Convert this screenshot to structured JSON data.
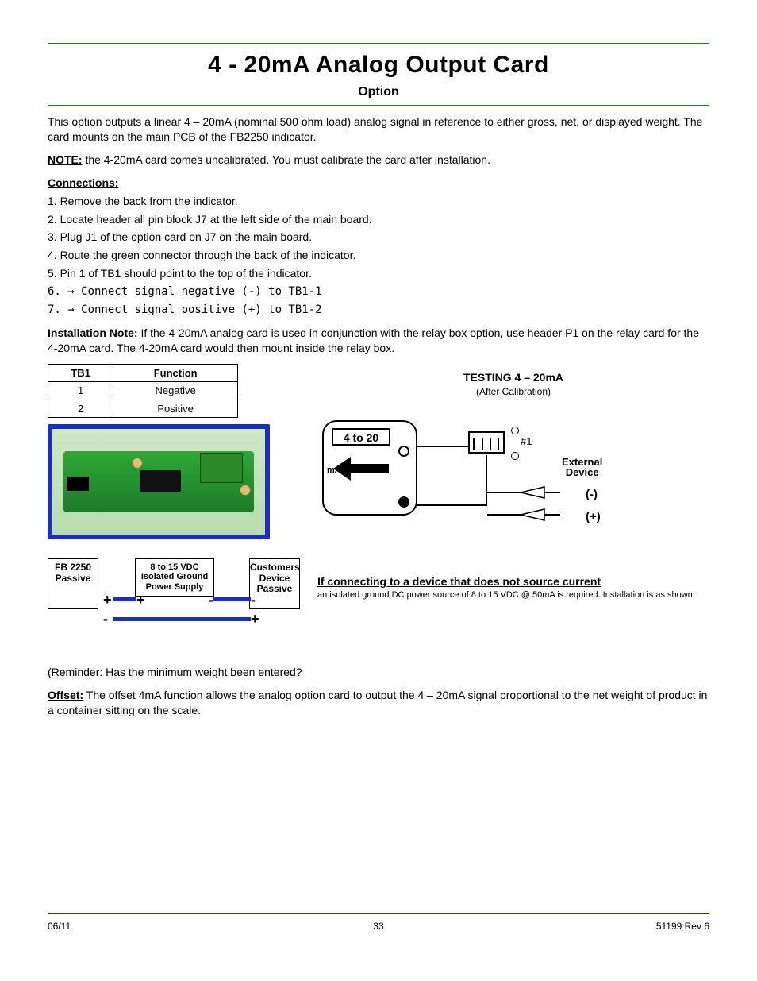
{
  "header": {
    "title": "4 - 20mA Analog Output Card",
    "subtitle": "Option"
  },
  "intro": "This option outputs a linear 4 – 20mA (nominal 500 ohm load) analog signal in reference to either gross, net, or displayed weight. The card mounts on the main PCB of the FB2250 indicator.",
  "note_label": "NOTE:",
  "note_text": " the 4-20mA card comes uncalibrated. You must calibrate the card after installation.",
  "conn_label": "Connections:",
  "conn_steps": [
    "1. Remove the back from the indicator.",
    "2. Locate header all pin block J7 at the left side of the main board.",
    "3. Plug J1 of the option card on J7 on the main board.",
    "4. Route the green connector through the back of the indicator.",
    "5. Pin 1 of TB1 should point to the top of the indicator.",
    "6. → Connect signal negative (-) to TB1-1",
    "7. → Connect signal positive (+) to TB1-2"
  ],
  "install_note_label": "Installation Note:",
  "install_note_text": " If the 4-20mA analog card is used in conjunction with the relay box option, use header P1 on the relay card for the 4-20mA card. The 4-20mA card would then mount inside the relay box.",
  "right_heading": "TESTING 4 – 20mA",
  "right_sub": "(After Calibration)",
  "tb1": {
    "col1": "TB1",
    "col2": "Function",
    "row1a": "1",
    "row1b": "Negative",
    "row2a": "2",
    "row2b": "Positive"
  },
  "diagram": {
    "readout": "4 to 20",
    "ma": "mA",
    "pin1": "#1",
    "ext1": "External",
    "ext2": "Device",
    "minus": "(-)",
    "plus": "(+)"
  },
  "passive_boxes": {
    "fb1": "FB 2250",
    "fb2": "Passive",
    "ps1": "8 to 15 VDC",
    "ps2": "Isolated Ground",
    "ps3": "Power Supply",
    "cd1": "Customers",
    "cd2": "Device",
    "cd3": "Passive"
  },
  "iso_src": {
    "label": "If connecting to a device that does not source current",
    "sub": "an isolated ground DC power source of 8 to 15 VDC @ 50mA is required. Installation is as shown:"
  },
  "footer": {
    "left": "06/11",
    "right": "51199 Rev 6",
    "page": "33"
  },
  "offset_reminder": "(Reminder: Has the minimum weight been entered?",
  "offset_label": "Offset:",
  "offset_text": " The offset 4mA function allows the analog option card to output the 4 – 20mA signal proportional to the net weight of product in a container sitting on the scale."
}
